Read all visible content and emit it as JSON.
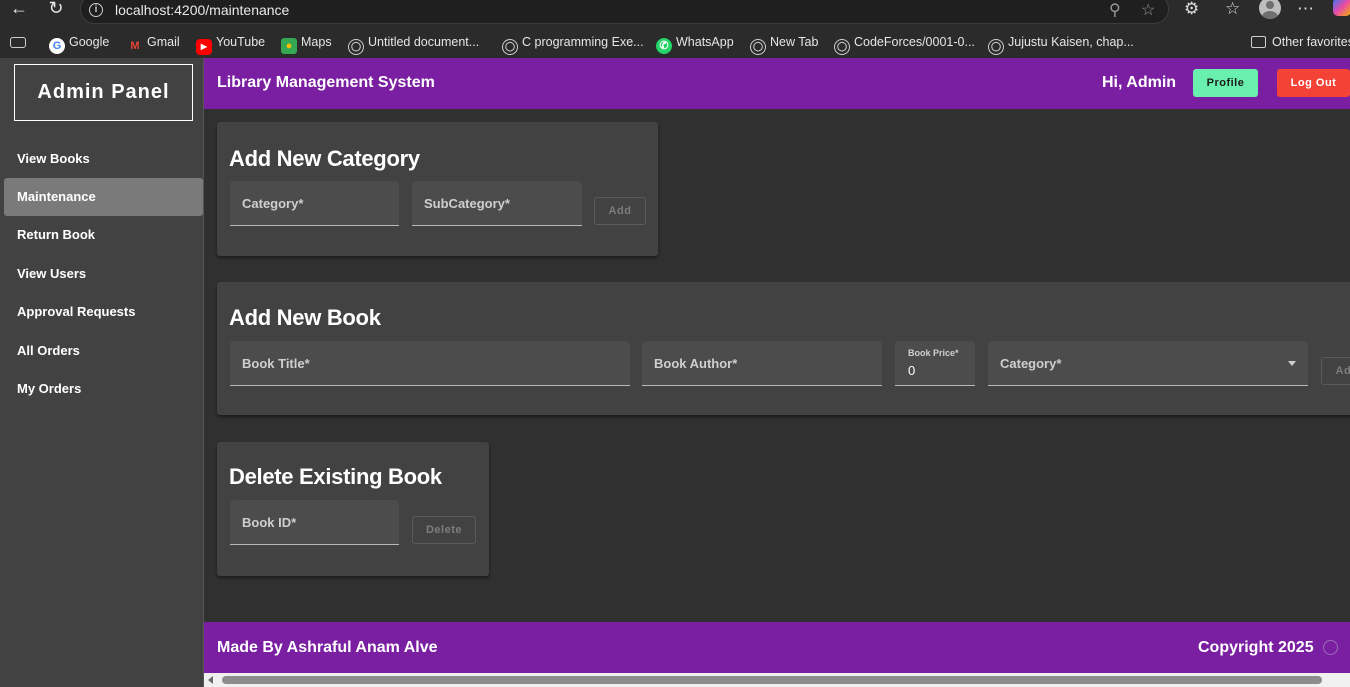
{
  "browser": {
    "url": "localhost:4200/maintenance",
    "bookmarks": [
      "Google",
      "Gmail",
      "YouTube",
      "Maps",
      "Untitled document...",
      "C programming Exe...",
      "WhatsApp",
      "New Tab",
      "CodeForces/0001-0...",
      "Jujustu Kaisen, chap..."
    ],
    "other_favorites": "Other favorites",
    "icons": [
      "back-icon",
      "refresh-icon",
      "info-icon",
      "zoom-icon",
      "star-icon",
      "extensions-icon",
      "favorites-icon",
      "profile-icon",
      "more-icon",
      "copilot-icon"
    ]
  },
  "sidebar": {
    "brand": "Admin Panel",
    "items": [
      {
        "label": "View Books"
      },
      {
        "label": "Maintenance",
        "active": true
      },
      {
        "label": "Return Book"
      },
      {
        "label": "View Users"
      },
      {
        "label": "Approval Requests"
      },
      {
        "label": "All Orders"
      },
      {
        "label": "My Orders"
      }
    ]
  },
  "header": {
    "title": "Library Management System",
    "greeting": "Hi, Admin",
    "profile_label": "Profile",
    "logout_label": "Log Out"
  },
  "add_category": {
    "title": "Add New Category",
    "category_label": "Category*",
    "subcategory_label": "SubCategory*",
    "add_label": "Add"
  },
  "add_book": {
    "title": "Add New Book",
    "book_title_label": "Book Title*",
    "book_author_label": "Book Author*",
    "book_price_label": "Book Price*",
    "book_price_value": "0",
    "category_label": "Category*",
    "add_label": "Add"
  },
  "delete_book": {
    "title": "Delete Existing Book",
    "book_id_label": "Book ID*",
    "delete_label": "Delete"
  },
  "footer": {
    "made_by": "Made By Ashraful Anam Alve",
    "copyright": "Copyright 2025"
  },
  "colors": {
    "primary": "#7b1fa2",
    "profile_button": "#69f0ae",
    "logout_button": "#f44336",
    "sidebar_bg": "#424242",
    "content_bg": "#303030"
  }
}
